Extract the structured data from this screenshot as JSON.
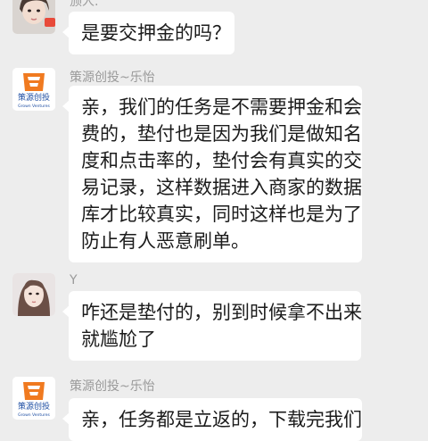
{
  "messages": [
    {
      "sender": "颁人.",
      "avatar": "girl-photo-avatar",
      "lines": [
        "是要交押金的吗？"
      ]
    },
    {
      "sender": "策源创投~乐怡",
      "avatar": "brand-logo-avatar",
      "avatar_text": "策源创投",
      "avatar_subtext": "Grown Ventures",
      "lines": [
        "亲，我们的任务是不需要押金和会",
        "费的，垫付也是因为我们是做知名",
        "度和点击率的，垫付会有真实的交",
        "易记录，这样数据进入商家的数据",
        "库才比较真实，同时这样也是为了",
        "防止有人恶意刷单。"
      ]
    },
    {
      "sender": "Y",
      "avatar": "girl-photo-avatar",
      "lines": [
        "咋还是垫付的，别到时候拿不出来",
        "就尴尬了"
      ]
    },
    {
      "sender": "策源创投~乐怡",
      "avatar": "brand-logo-avatar",
      "avatar_text": "策源创投",
      "avatar_subtext": "Grown Ventures",
      "lines": [
        "亲，任务都是立返的，下载完我们"
      ]
    }
  ],
  "colors": {
    "background": "#ededed",
    "bubble": "#ffffff",
    "brand_orange": "#f07a20",
    "brand_blue": "#1f4fa3"
  }
}
